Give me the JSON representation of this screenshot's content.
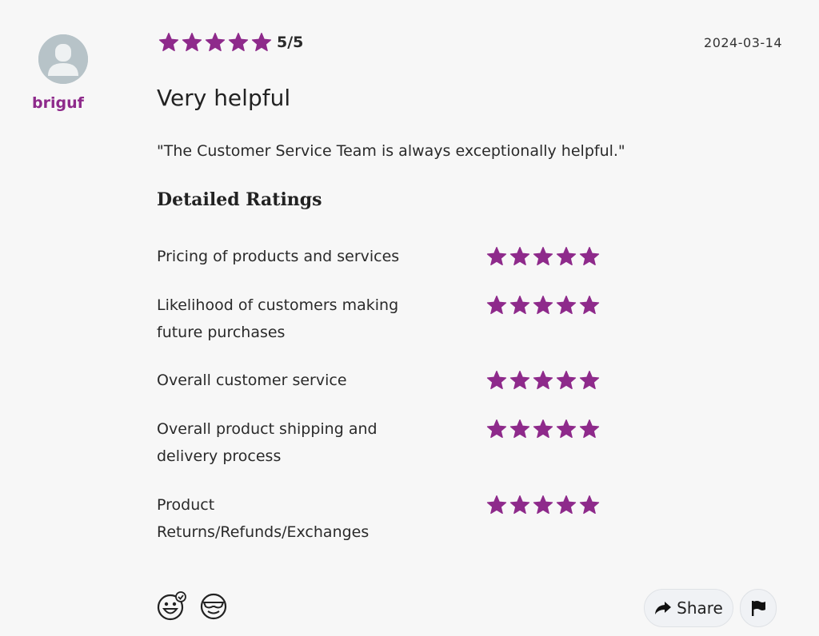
{
  "reviewer": {
    "username": "briguf"
  },
  "review": {
    "overall_rating": 5,
    "overall_max": 5,
    "overall_label": "5/5",
    "date": "2024-03-14",
    "title": "Very helpful",
    "quote": "\"The Customer Service Team is always exceptionally helpful.\""
  },
  "detailed": {
    "heading": "Detailed Ratings",
    "items": [
      {
        "label": "Pricing of products and services",
        "rating": 5
      },
      {
        "label": "Likelihood of customers making future purchases",
        "rating": 5
      },
      {
        "label": "Overall customer service",
        "rating": 5
      },
      {
        "label": "Overall product shipping and delivery process",
        "rating": 5
      },
      {
        "label": "Product Returns/Refunds/Exchanges",
        "rating": 5
      }
    ]
  },
  "actions": {
    "share_label": "Share",
    "reactions": [
      "smile-add-reaction-icon",
      "cool-face-icon",
      "share-arrow-icon",
      "flag-icon"
    ]
  },
  "colors": {
    "star": "#8e2a8b",
    "username": "#8e2a8b",
    "background": "#f7f7f7"
  }
}
